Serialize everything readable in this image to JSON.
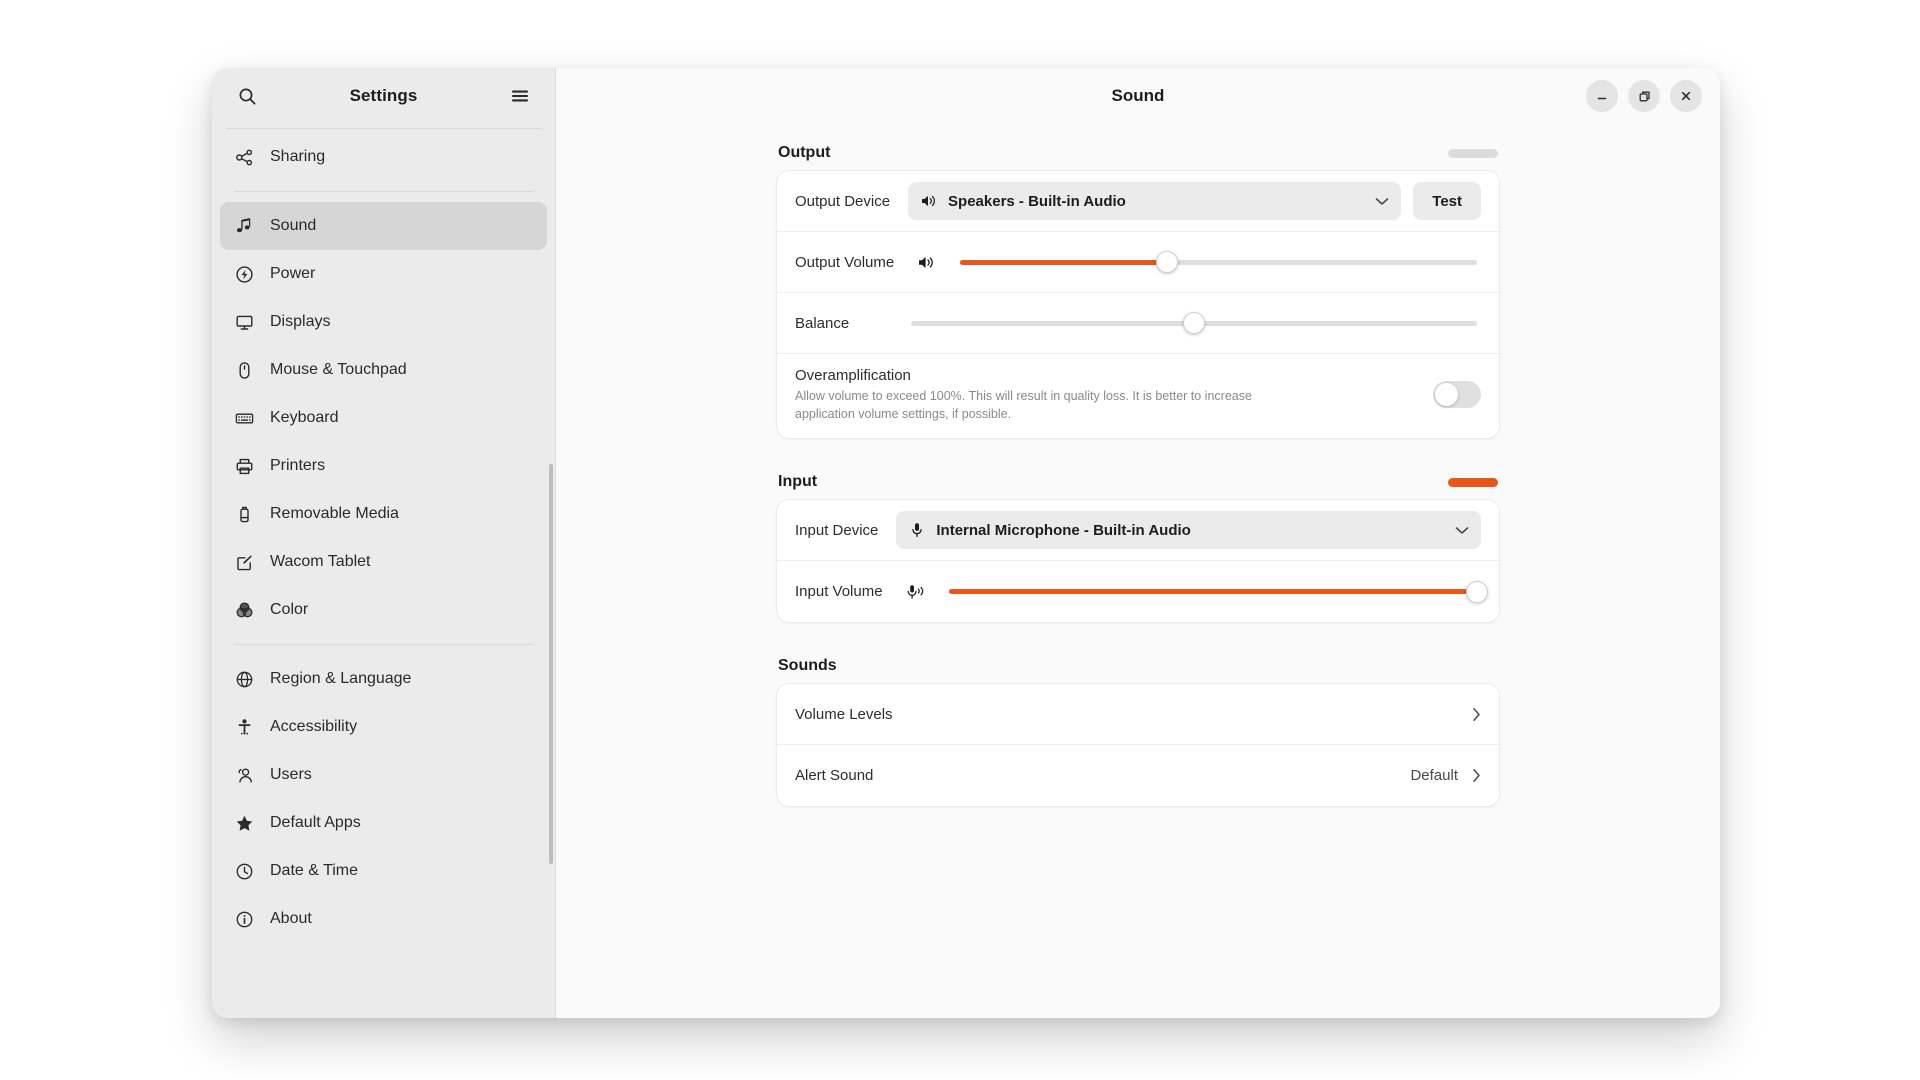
{
  "window": {
    "title": "Sound",
    "controls": [
      {
        "name": "minimize",
        "glyph": "minimize-icon"
      },
      {
        "name": "maximize",
        "glyph": "maximize-icon"
      },
      {
        "name": "close",
        "glyph": "close-icon"
      }
    ]
  },
  "sidebar": {
    "title": "Settings",
    "search_icon": "search-icon",
    "menu_icon": "hamburger-menu-icon",
    "items": [
      {
        "label": "Sharing",
        "icon": "share-icon",
        "selected": false
      },
      {
        "label": "Sound",
        "icon": "music-note-icon",
        "selected": true
      },
      {
        "label": "Power",
        "icon": "power-bolt-icon",
        "selected": false
      },
      {
        "label": "Displays",
        "icon": "monitor-icon",
        "selected": false
      },
      {
        "label": "Mouse & Touchpad",
        "icon": "mouse-icon",
        "selected": false
      },
      {
        "label": "Keyboard",
        "icon": "keyboard-icon",
        "selected": false
      },
      {
        "label": "Printers",
        "icon": "printer-icon",
        "selected": false
      },
      {
        "label": "Removable Media",
        "icon": "usb-drive-icon",
        "selected": false
      },
      {
        "label": "Wacom Tablet",
        "icon": "tablet-pen-icon",
        "selected": false
      },
      {
        "label": "Color",
        "icon": "color-circles-icon",
        "selected": false
      },
      {
        "label": "Region & Language",
        "icon": "globe-icon",
        "selected": false
      },
      {
        "label": "Accessibility",
        "icon": "accessibility-icon",
        "selected": false
      },
      {
        "label": "Users",
        "icon": "users-icon",
        "selected": false
      },
      {
        "label": "Default Apps",
        "icon": "star-icon",
        "selected": false
      },
      {
        "label": "Date & Time",
        "icon": "clock-icon",
        "selected": false
      },
      {
        "label": "About",
        "icon": "info-icon",
        "selected": false
      }
    ]
  },
  "accent_color": "#e8561b",
  "output": {
    "section_title": "Output",
    "level_meter_active": false,
    "device_label": "Output Device",
    "device_value": "Speakers - Built-in Audio",
    "device_icon": "speaker-icon",
    "test_label": "Test",
    "volume_label": "Output Volume",
    "volume_icon": "speaker-icon",
    "volume_percent": 40,
    "balance_label": "Balance",
    "balance_percent": 50,
    "overamplification_title": "Overamplification",
    "overamplification_desc": "Allow volume to exceed 100%. This will result in quality loss. It is better to increase application volume settings, if possible.",
    "overamplification_on": false
  },
  "input": {
    "section_title": "Input",
    "level_meter_active": true,
    "device_label": "Input Device",
    "device_value": "Internal Microphone - Built-in Audio",
    "device_icon": "microphone-icon",
    "volume_label": "Input Volume",
    "volume_icon": "microphone-level-icon",
    "volume_percent": 100
  },
  "sounds": {
    "section_title": "Sounds",
    "volume_levels_label": "Volume Levels",
    "alert_sound_label": "Alert Sound",
    "alert_sound_value": "Default"
  }
}
